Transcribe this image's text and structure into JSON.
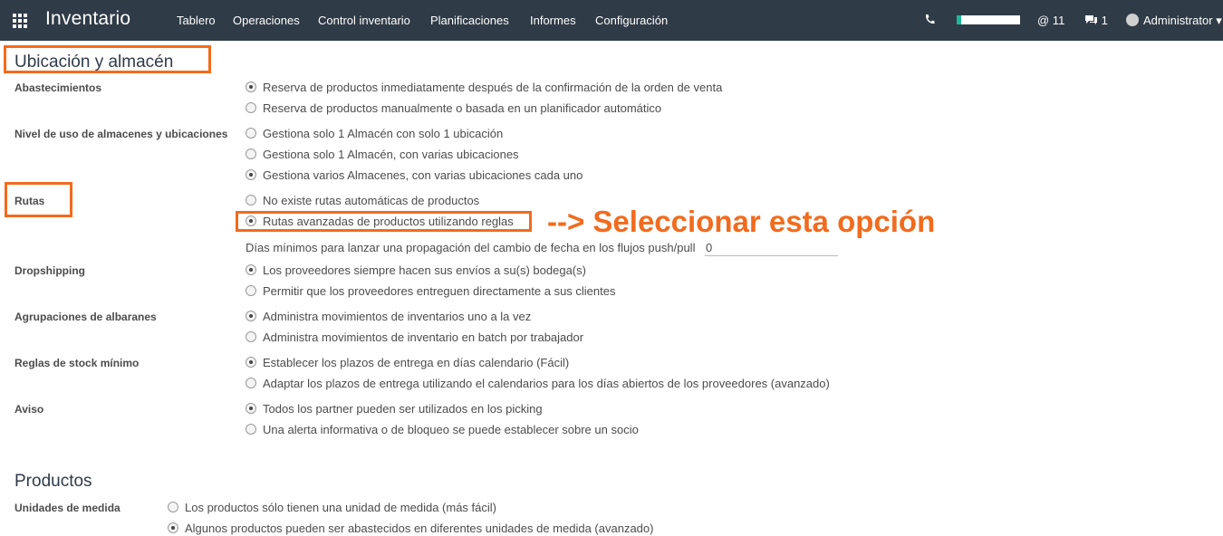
{
  "topbar": {
    "app_title": "Inventario",
    "menu": [
      "Tablero",
      "Operaciones",
      "Control inventario",
      "Planificaciones",
      "Informes",
      "Configuración"
    ],
    "mentions": "@ 11",
    "messages": "1",
    "user": "Administrator",
    "bg_color": "#2f3b47"
  },
  "section1_title": "Ubicación y almacén",
  "groups": {
    "abastecimientos": {
      "label": "Abastecimientos",
      "options": [
        "Reserva de productos inmediatamente después de la confirmación de la orden de venta",
        "Reserva de productos manualmente o basada en un planificador automático"
      ],
      "selected": 0
    },
    "nivel": {
      "label": "Nivel de uso de almacenes y ubicaciones",
      "options": [
        "Gestiona solo 1 Almacén con solo 1 ubicación",
        "Gestiona solo 1 Almacén, con varias ubicaciones",
        "Gestiona varios Almacenes, con varias ubicaciones cada uno"
      ],
      "selected": 2
    },
    "rutas": {
      "label": "Rutas",
      "options": [
        "No existe rutas automáticas de productos",
        "Rutas avanzadas de productos utilizando reglas"
      ],
      "selected": 1,
      "days_label": "Días mínimos para lanzar una propagación del cambio de fecha en los flujos push/pull",
      "days_value": "0"
    },
    "dropshipping": {
      "label": "Dropshipping",
      "options": [
        "Los proveedores siempre hacen sus envíos a su(s) bodega(s)",
        "Permitir que los proveedores entreguen directamente a sus clientes"
      ],
      "selected": 0
    },
    "agrupaciones": {
      "label": "Agrupaciones de albaranes",
      "options": [
        "Administra movimientos de inventarios uno a la vez",
        "Administra movimientos de inventario en batch por trabajador"
      ],
      "selected": 0
    },
    "reglas": {
      "label": "Reglas de stock mínimo",
      "options": [
        "Establecer los plazos de entrega en días calendario (Fácil)",
        "Adaptar los plazos de entrega utilizando el calendarios para los días abiertos de los proveedores (avanzado)"
      ],
      "selected": 0
    },
    "aviso": {
      "label": "Aviso",
      "options": [
        "Todos los partner pueden ser utilizados en los picking",
        "Una alerta informativa o de bloqueo se puede establecer sobre un socio"
      ],
      "selected": 0
    }
  },
  "section2_title": "Productos",
  "unidades": {
    "label": "Unidades de medida",
    "options": [
      "Los productos sólo tienen una unidad de medida (más fácil)",
      "Algunos productos pueden ser abastecidos en diferentes unidades de medida (avanzado)"
    ],
    "selected": 1
  },
  "annotation": "--> Seleccionar esta opción",
  "annotation_color": "#f26b1d"
}
